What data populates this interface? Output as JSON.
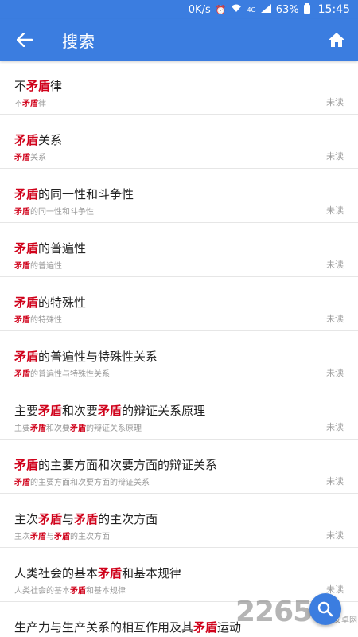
{
  "status_bar": {
    "speed": "0K/s",
    "network": "4G",
    "battery": "63%",
    "time": "15:45",
    "icons": [
      "alarm-icon",
      "wifi-icon",
      "signal-icon",
      "battery-icon"
    ]
  },
  "app_bar": {
    "title": "搜索",
    "back_icon": "arrow-left-icon",
    "home_icon": "home-icon"
  },
  "keyword": "矛盾",
  "results": [
    {
      "title": "不矛盾律",
      "subtitle": "不矛盾律",
      "status": "未读"
    },
    {
      "title": "矛盾关系",
      "subtitle": "矛盾关系",
      "status": "未读"
    },
    {
      "title": "矛盾的同一性和斗争性",
      "subtitle": "矛盾的同一性和斗争性",
      "status": "未读"
    },
    {
      "title": "矛盾的普遍性",
      "subtitle": "矛盾的普遍性",
      "status": "未读"
    },
    {
      "title": "矛盾的特殊性",
      "subtitle": "矛盾的特殊性",
      "status": "未读"
    },
    {
      "title": "矛盾的普遍性与特殊性关系",
      "subtitle": "矛盾的普遍性与特殊性关系",
      "status": "未读"
    },
    {
      "title": "主要矛盾和次要矛盾的辩证关系原理",
      "subtitle": "主要矛盾和次要矛盾的辩证关系原理",
      "status": "未读"
    },
    {
      "title": "矛盾的主要方面和次要方面的辩证关系",
      "subtitle": "矛盾的主要方面和次要方面的辩证关系",
      "status": "未读"
    },
    {
      "title": "主次矛盾与矛盾的主次方面",
      "subtitle": "主次矛盾与矛盾的主次方面",
      "status": "未读"
    },
    {
      "title": "人类社会的基本矛盾和基本规律",
      "subtitle": "人类社会的基本矛盾和基本规律",
      "status": "未读"
    },
    {
      "title": "生产力与生产关系的相互作用及其矛盾运动",
      "subtitle": "",
      "status": ""
    }
  ],
  "fab": {
    "icon": "search-icon"
  },
  "watermark": {
    "text": "2265",
    "small": "安卓网"
  },
  "colors": {
    "primary": "#3b7de0",
    "highlight": "#d0021b",
    "title_text": "#222222",
    "sub_text": "#9a9a9a"
  }
}
